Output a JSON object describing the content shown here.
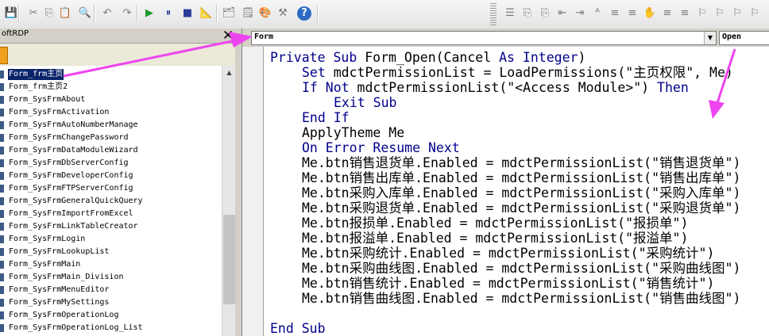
{
  "toolbar": {
    "buttons": [
      {
        "name": "save-icon",
        "glyph": "💾"
      },
      {
        "name": "cut-icon",
        "glyph": "✂"
      },
      {
        "name": "copy-icon",
        "glyph": "⎘"
      },
      {
        "name": "paste-icon",
        "glyph": "📋"
      },
      {
        "name": "find-icon",
        "glyph": "🔍"
      },
      {
        "name": "undo-icon",
        "glyph": "↶"
      },
      {
        "name": "redo-icon",
        "glyph": "↷"
      },
      {
        "name": "run-icon",
        "glyph": "▶"
      },
      {
        "name": "break-icon",
        "glyph": "⏸"
      },
      {
        "name": "reset-icon",
        "glyph": "■"
      },
      {
        "name": "design-mode-icon",
        "glyph": "📐"
      },
      {
        "name": "project-explorer-icon",
        "glyph": "🗂"
      },
      {
        "name": "properties-icon",
        "glyph": "🗒"
      },
      {
        "name": "object-browser-icon",
        "glyph": "🎨"
      },
      {
        "name": "toolbox-icon",
        "glyph": "⚒"
      }
    ],
    "help_glyph": "?"
  },
  "project_pane": {
    "title": "oftRDP",
    "close_glyph": "✕",
    "items": [
      "Form_frm主页",
      "Form_frm主页2",
      "Form_SysFrmAbout",
      "Form_SysFrmActivation",
      "Form_SysFrmAutoNumberManage",
      "Form_SysFrmChangePassword",
      "Form_SysFrmDataModuleWizard",
      "Form_SysFrmDbServerConfig",
      "Form_SysFrmDeveloperConfig",
      "Form_SysFrmFTPServerConfig",
      "Form_SysFrmGeneralQuickQuery",
      "Form_SysFrmImportFromExcel",
      "Form_SysFrmLinkTableCreator",
      "Form_SysFrmLogin",
      "Form_SysFrmLookupList",
      "Form_SysFrmMain",
      "Form_SysFrmMain_Division",
      "Form_SysFrmMenuEditor",
      "Form_SysFrmMySettings",
      "Form_SysFrmOperationLog",
      "Form_SysFrmOperationLog_List"
    ],
    "selected_index": 0
  },
  "code_window": {
    "object_combo": "Form",
    "procedure_combo": "Open",
    "lines": [
      {
        "indent": 0,
        "parts": [
          [
            "kw",
            "Private Sub "
          ],
          [
            "",
            "Form_Open(Cancel "
          ],
          [
            "kw",
            "As Integer"
          ],
          [
            "",
            ")"
          ]
        ]
      },
      {
        "indent": 1,
        "parts": [
          [
            "kw",
            "Set "
          ],
          [
            "",
            "mdctPermissionList = LoadPermissions(\"主页权限\", Me)"
          ]
        ]
      },
      {
        "indent": 1,
        "parts": [
          [
            "kw",
            "If Not "
          ],
          [
            "",
            "mdctPermissionList(\"<Access Module>\") "
          ],
          [
            "kw",
            "Then"
          ]
        ]
      },
      {
        "indent": 2,
        "parts": [
          [
            "kw",
            "Exit Sub"
          ]
        ]
      },
      {
        "indent": 1,
        "parts": [
          [
            "kw",
            "End If"
          ]
        ]
      },
      {
        "indent": 1,
        "parts": [
          [
            "",
            "ApplyTheme Me"
          ]
        ]
      },
      {
        "indent": 1,
        "parts": [
          [
            "kw",
            "On Error Resume Next"
          ]
        ]
      },
      {
        "indent": 1,
        "parts": [
          [
            "",
            "Me.btn销售退货单.Enabled = mdctPermissionList(\"销售退货单\")"
          ]
        ]
      },
      {
        "indent": 1,
        "parts": [
          [
            "",
            "Me.btn销售出库单.Enabled = mdctPermissionList(\"销售出库单\")"
          ]
        ]
      },
      {
        "indent": 1,
        "parts": [
          [
            "",
            "Me.btn采购入库单.Enabled = mdctPermissionList(\"采购入库单\")"
          ]
        ]
      },
      {
        "indent": 1,
        "parts": [
          [
            "",
            "Me.btn采购退货单.Enabled = mdctPermissionList(\"采购退货单\")"
          ]
        ]
      },
      {
        "indent": 1,
        "parts": [
          [
            "",
            "Me.btn报损单.Enabled = mdctPermissionList(\"报损单\")"
          ]
        ]
      },
      {
        "indent": 1,
        "parts": [
          [
            "",
            "Me.btn报溢单.Enabled = mdctPermissionList(\"报溢单\")"
          ]
        ]
      },
      {
        "indent": 1,
        "parts": [
          [
            "",
            "Me.btn采购统计.Enabled = mdctPermissionList(\"采购统计\")"
          ]
        ]
      },
      {
        "indent": 1,
        "parts": [
          [
            "",
            "Me.btn采购曲线图.Enabled = mdctPermissionList(\"采购曲线图\")"
          ]
        ]
      },
      {
        "indent": 1,
        "parts": [
          [
            "",
            "Me.btn销售统计.Enabled = mdctPermissionList(\"销售统计\")"
          ]
        ]
      },
      {
        "indent": 1,
        "parts": [
          [
            "",
            "Me.btn销售曲线图.Enabled = mdctPermissionList(\"销售曲线图\")"
          ]
        ]
      },
      {
        "indent": 0,
        "parts": [
          [
            "",
            ""
          ]
        ]
      },
      {
        "indent": 0,
        "parts": [
          [
            "kw",
            "End Sub"
          ]
        ]
      }
    ]
  },
  "colors": {
    "keyword": "#00008b",
    "selection": "#0a246a",
    "annotation_arrow": "#ee44ee"
  }
}
